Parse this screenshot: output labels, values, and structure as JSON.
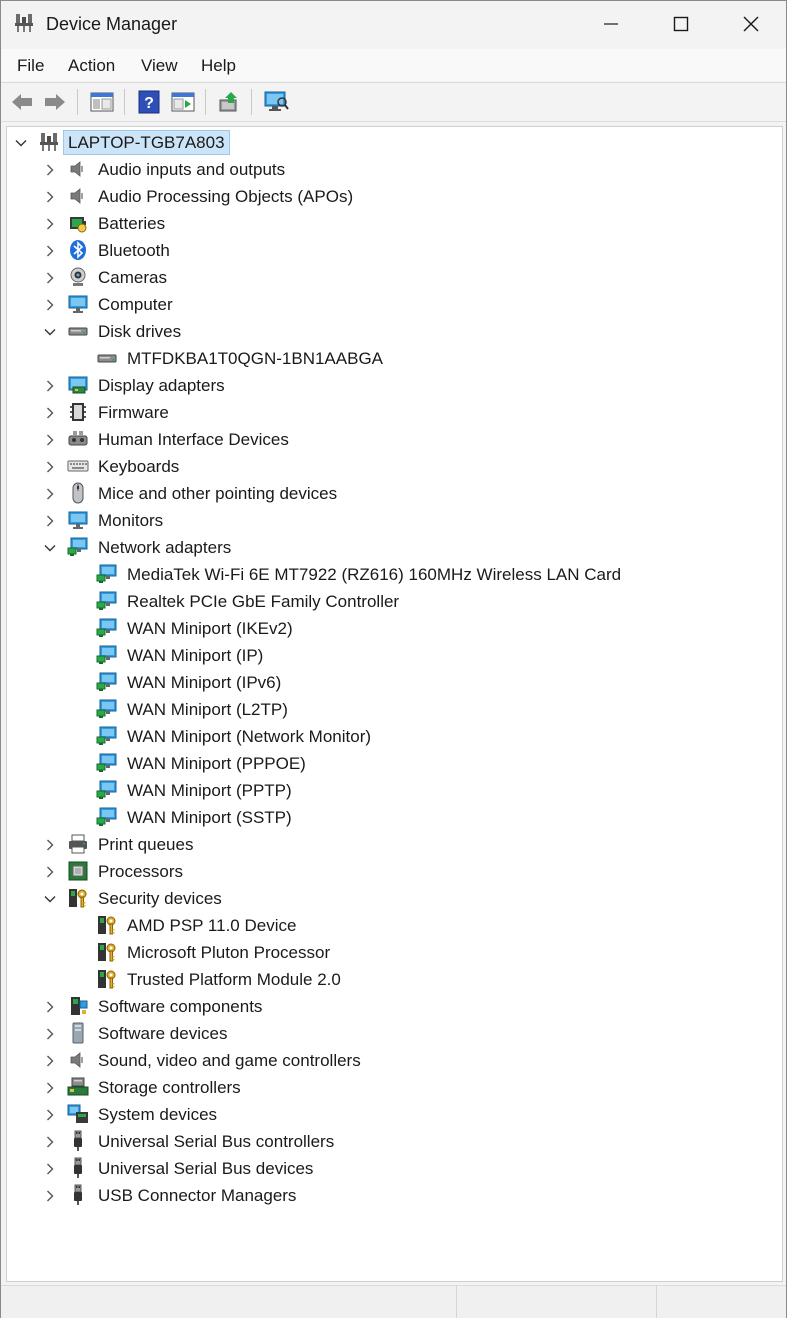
{
  "window": {
    "title": "Device Manager"
  },
  "menu": [
    {
      "label": "File"
    },
    {
      "label": "Action"
    },
    {
      "label": "View"
    },
    {
      "label": "Help"
    }
  ],
  "toolbar": [
    {
      "name": "back-button",
      "icon": "arrow-left-icon"
    },
    {
      "name": "forward-button",
      "icon": "arrow-right-icon"
    },
    {
      "name": "show-hide-console-tree-button",
      "icon": "console-tree-icon"
    },
    {
      "name": "help-button",
      "icon": "help-icon"
    },
    {
      "name": "properties-button",
      "icon": "properties-icon"
    },
    {
      "name": "update-driver-button",
      "icon": "update-driver-icon"
    },
    {
      "name": "scan-hardware-button",
      "icon": "scan-hardware-icon"
    }
  ],
  "tree": {
    "root": {
      "label": "LAPTOP-TGB7A803",
      "expanded": true,
      "icon": "computer-network-icon"
    },
    "items": [
      {
        "label": "Audio inputs and outputs",
        "level": 1,
        "expanded": false,
        "icon": "speaker-icon"
      },
      {
        "label": "Audio Processing Objects (APOs)",
        "level": 1,
        "expanded": false,
        "icon": "speaker-icon"
      },
      {
        "label": "Batteries",
        "level": 1,
        "expanded": false,
        "icon": "battery-icon"
      },
      {
        "label": "Bluetooth",
        "level": 1,
        "expanded": false,
        "icon": "bluetooth-icon"
      },
      {
        "label": "Cameras",
        "level": 1,
        "expanded": false,
        "icon": "camera-icon"
      },
      {
        "label": "Computer",
        "level": 1,
        "expanded": false,
        "icon": "monitor-icon"
      },
      {
        "label": "Disk drives",
        "level": 1,
        "expanded": true,
        "icon": "disk-drive-icon"
      },
      {
        "label": "MTFDKBA1T0QGN-1BN1AABGA",
        "level": 2,
        "icon": "disk-drive-icon"
      },
      {
        "label": "Display adapters",
        "level": 1,
        "expanded": false,
        "icon": "display-adapter-icon"
      },
      {
        "label": "Firmware",
        "level": 1,
        "expanded": false,
        "icon": "firmware-icon"
      },
      {
        "label": "Human Interface Devices",
        "level": 1,
        "expanded": false,
        "icon": "hid-icon"
      },
      {
        "label": "Keyboards",
        "level": 1,
        "expanded": false,
        "icon": "keyboard-icon"
      },
      {
        "label": "Mice and other pointing devices",
        "level": 1,
        "expanded": false,
        "icon": "mouse-icon"
      },
      {
        "label": "Monitors",
        "level": 1,
        "expanded": false,
        "icon": "monitor-icon"
      },
      {
        "label": "Network adapters",
        "level": 1,
        "expanded": true,
        "icon": "network-adapter-icon"
      },
      {
        "label": "MediaTek Wi-Fi 6E MT7922 (RZ616) 160MHz Wireless LAN Card",
        "level": 2,
        "icon": "network-adapter-icon"
      },
      {
        "label": "Realtek PCIe GbE Family Controller",
        "level": 2,
        "icon": "network-adapter-icon"
      },
      {
        "label": "WAN Miniport (IKEv2)",
        "level": 2,
        "icon": "network-adapter-icon"
      },
      {
        "label": "WAN Miniport (IP)",
        "level": 2,
        "icon": "network-adapter-icon"
      },
      {
        "label": "WAN Miniport (IPv6)",
        "level": 2,
        "icon": "network-adapter-icon"
      },
      {
        "label": "WAN Miniport (L2TP)",
        "level": 2,
        "icon": "network-adapter-icon"
      },
      {
        "label": "WAN Miniport (Network Monitor)",
        "level": 2,
        "icon": "network-adapter-icon"
      },
      {
        "label": "WAN Miniport (PPPOE)",
        "level": 2,
        "icon": "network-adapter-icon"
      },
      {
        "label": "WAN Miniport (PPTP)",
        "level": 2,
        "icon": "network-adapter-icon"
      },
      {
        "label": "WAN Miniport (SSTP)",
        "level": 2,
        "icon": "network-adapter-icon"
      },
      {
        "label": "Print queues",
        "level": 1,
        "expanded": false,
        "icon": "printer-icon"
      },
      {
        "label": "Processors",
        "level": 1,
        "expanded": false,
        "icon": "processor-icon"
      },
      {
        "label": "Security devices",
        "level": 1,
        "expanded": true,
        "icon": "security-key-icon"
      },
      {
        "label": "AMD PSP 11.0 Device",
        "level": 2,
        "icon": "security-key-icon"
      },
      {
        "label": "Microsoft Pluton Processor",
        "level": 2,
        "icon": "security-key-icon"
      },
      {
        "label": "Trusted Platform Module 2.0",
        "level": 2,
        "icon": "security-key-icon"
      },
      {
        "label": "Software components",
        "level": 1,
        "expanded": false,
        "icon": "software-component-icon"
      },
      {
        "label": "Software devices",
        "level": 1,
        "expanded": false,
        "icon": "software-device-icon"
      },
      {
        "label": "Sound, video and game controllers",
        "level": 1,
        "expanded": false,
        "icon": "speaker-icon"
      },
      {
        "label": "Storage controllers",
        "level": 1,
        "expanded": false,
        "icon": "storage-controller-icon"
      },
      {
        "label": "System devices",
        "level": 1,
        "expanded": false,
        "icon": "system-devices-icon"
      },
      {
        "label": "Universal Serial Bus controllers",
        "level": 1,
        "expanded": false,
        "icon": "usb-icon"
      },
      {
        "label": "Universal Serial Bus devices",
        "level": 1,
        "expanded": false,
        "icon": "usb-icon"
      },
      {
        "label": "USB Connector Managers",
        "level": 1,
        "expanded": false,
        "icon": "usb-icon"
      }
    ]
  },
  "colors": {
    "selection": "#cce4f7",
    "selection_border": "#99c9ef",
    "monitor_blue": "#2f9be0",
    "network_green": "#2aa84a"
  }
}
